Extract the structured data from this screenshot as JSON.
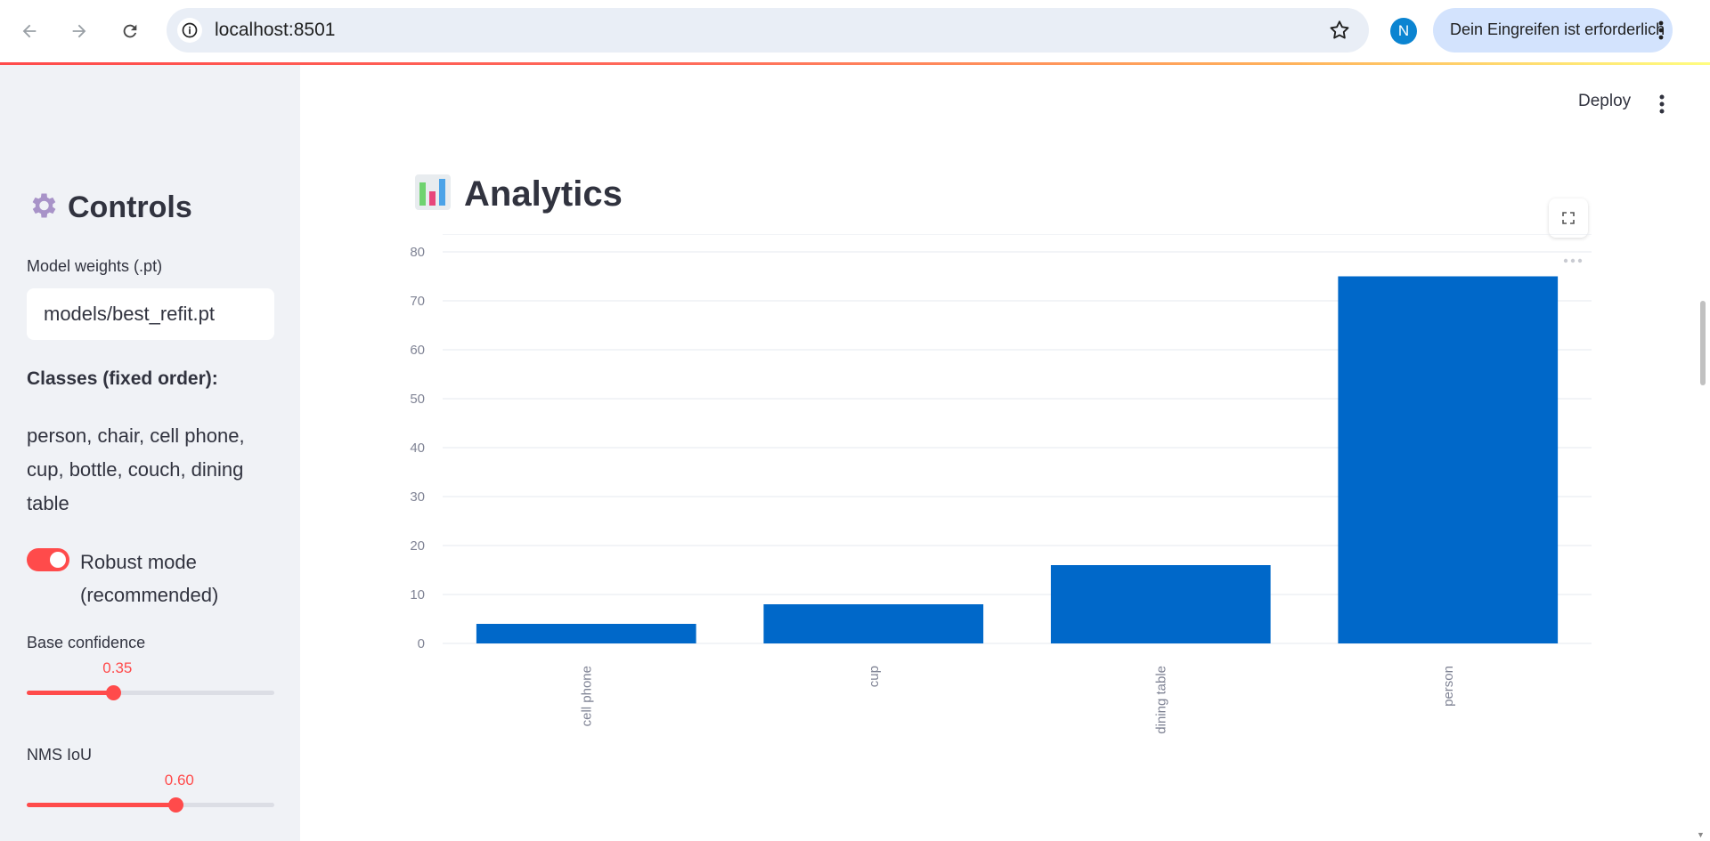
{
  "browser": {
    "url": "localhost:8501",
    "profile_initial": "N",
    "intervention_label": "Dein Eingreifen ist erforderlich"
  },
  "sidebar": {
    "title": "Controls",
    "title_icon": "gear-icon",
    "model_weights_label": "Model weights (.pt)",
    "model_weights_value": "models/best_refit.pt",
    "classes_heading": "Classes (fixed order):",
    "classes_list": "person, chair, cell phone, cup, bottle, couch, dining table",
    "robust_mode_label": "Robust mode (recommended)",
    "robust_mode_on": true,
    "base_conf": {
      "label": "Base confidence",
      "value": "0.35",
      "fraction": 0.35
    },
    "nms_iou": {
      "label": "NMS IoU",
      "value": "0.60",
      "fraction": 0.6
    }
  },
  "header": {
    "deploy_label": "Deploy"
  },
  "main": {
    "title": "Analytics",
    "title_icon": "bar-chart-icon"
  },
  "colors": {
    "accent": "#ff4b4b",
    "bar": "#0068c9",
    "sidebar_bg": "#f0f2f6"
  },
  "chart_data": {
    "type": "bar",
    "categories": [
      "cell phone",
      "cup",
      "dining table",
      "person"
    ],
    "values": [
      4,
      8,
      16,
      75
    ],
    "ylim": [
      0,
      80
    ],
    "yticks": [
      0,
      10,
      20,
      30,
      40,
      50,
      60,
      70,
      80
    ],
    "grid": true,
    "title": "",
    "xlabel": "",
    "ylabel": ""
  }
}
